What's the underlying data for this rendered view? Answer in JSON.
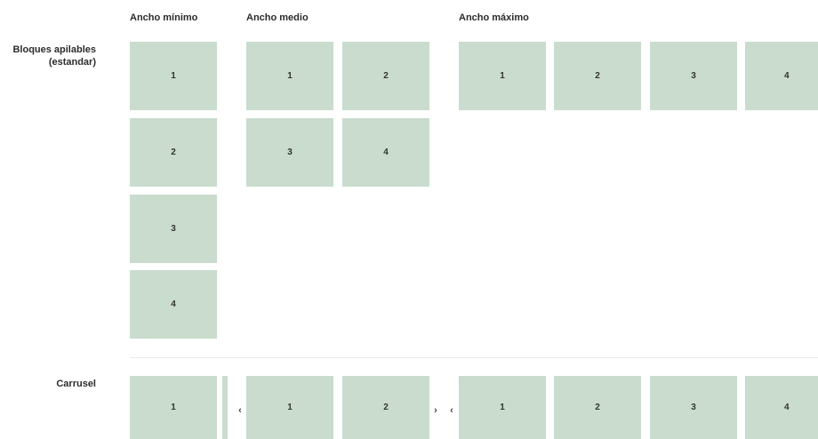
{
  "columns": {
    "min": "Ancho mínimo",
    "mid": "Ancho medio",
    "max": "Ancho máximo"
  },
  "rows": {
    "stacked_line1": "Bloques apilables",
    "stacked_line2": "(estandar)",
    "carousel": "Carrusel"
  },
  "stacked": {
    "min": [
      "1",
      "2",
      "3",
      "4"
    ],
    "mid": [
      "1",
      "2",
      "3",
      "4"
    ],
    "max": [
      "1",
      "2",
      "3",
      "4"
    ]
  },
  "carousel": {
    "min": [
      "1"
    ],
    "mid": [
      "1",
      "2"
    ],
    "max": [
      "1",
      "2",
      "3",
      "4"
    ],
    "prev_glyph": "‹",
    "next_glyph": "›"
  },
  "colors": {
    "tile": "#c9dccd",
    "divider": "#ececec"
  }
}
